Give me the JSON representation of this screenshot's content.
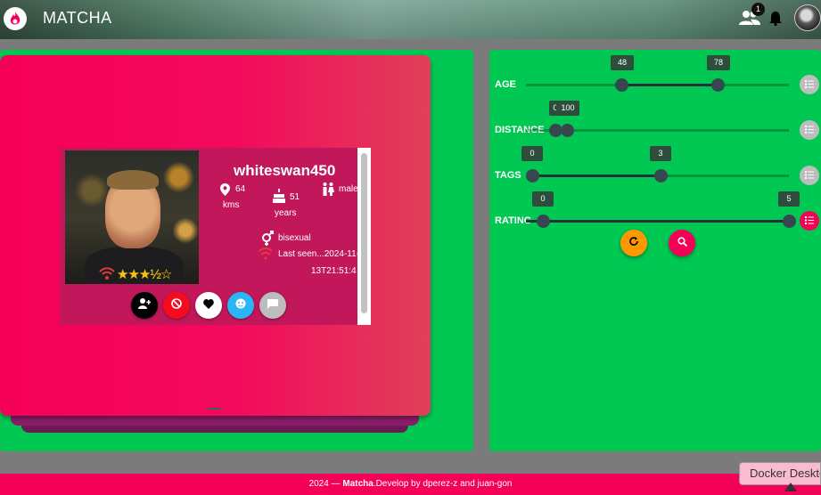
{
  "header": {
    "app_name": "MATCHA",
    "notification_count": "1",
    "icons": [
      "flame-logo-icon",
      "people-icon",
      "bell-icon",
      "user-avatar"
    ]
  },
  "profile": {
    "username": "whiteswan450",
    "distance_value": "64",
    "distance_unit": "kms",
    "age_value": "51",
    "age_unit": "years",
    "gender": "male",
    "orientation": "bisexual",
    "last_seen_line1": "Last seen...2024-11-",
    "last_seen_line2": "13T21:51:4",
    "rating_stars": 3.5,
    "rating_max": 5
  },
  "actions": [
    {
      "name": "add-friend-button",
      "icon": "person-add-icon",
      "color": "#000000"
    },
    {
      "name": "block-button",
      "icon": "block-icon",
      "color": "#f50b1e"
    },
    {
      "name": "like-button",
      "icon": "heart-icon",
      "color": "#ffffff"
    },
    {
      "name": "visit-button",
      "icon": "face-icon",
      "color": "#29b6f6"
    },
    {
      "name": "chat-button",
      "icon": "chat-icon",
      "color": "#bdbdbd"
    }
  ],
  "filters": {
    "age": {
      "label": "AGE",
      "min": "48",
      "max": "78"
    },
    "distance": {
      "label": "DISTANCE",
      "min": "0",
      "max": "100"
    },
    "tags": {
      "label": "TAGS",
      "min": "0",
      "max": "3"
    },
    "rating": {
      "label": "RATING",
      "min": "0",
      "max": "5"
    }
  },
  "buttons": {
    "reset": "refresh-icon",
    "search": "search-icon"
  },
  "colors": {
    "accent_pink": "#f50057",
    "panel_green": "#00c853",
    "reset_orange": "#ff9800"
  },
  "footer": {
    "year": "2024 — ",
    "brand": "Matcha",
    "credit": ".Develop by dperez-z and juan-gon"
  },
  "overlay": {
    "docker_label": "Docker Desktop"
  }
}
